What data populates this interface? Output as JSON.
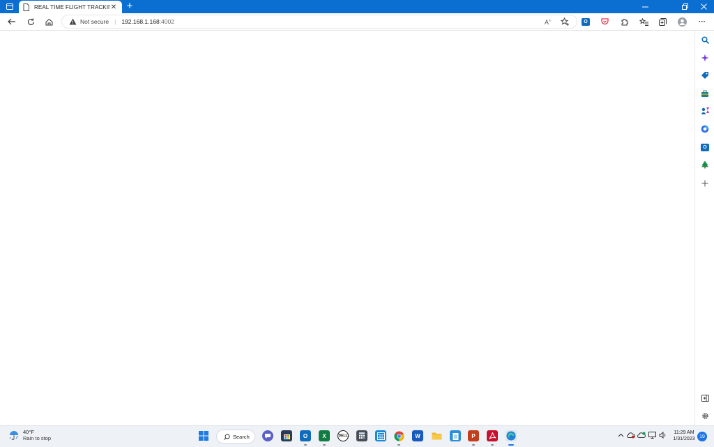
{
  "browser": {
    "tab_title": "REAL TIME FLIGHT TRACKING",
    "tab_close": "✕",
    "new_tab": "+",
    "address": {
      "security_label": "Not secure",
      "host": "192.168.1.168",
      "port": ":4002"
    },
    "more_menu": "···"
  },
  "taskbar": {
    "weather": {
      "temperature": "40°F",
      "condition": "Rain to stop"
    },
    "search_label": "Search",
    "clock": {
      "time": "11:29 AM",
      "date": "1/31/2023"
    },
    "notification_count": "19"
  },
  "colors": {
    "titlebar": "#0b6fd1",
    "taskbar": "#eef1f6",
    "accent": "#1a73e8"
  }
}
